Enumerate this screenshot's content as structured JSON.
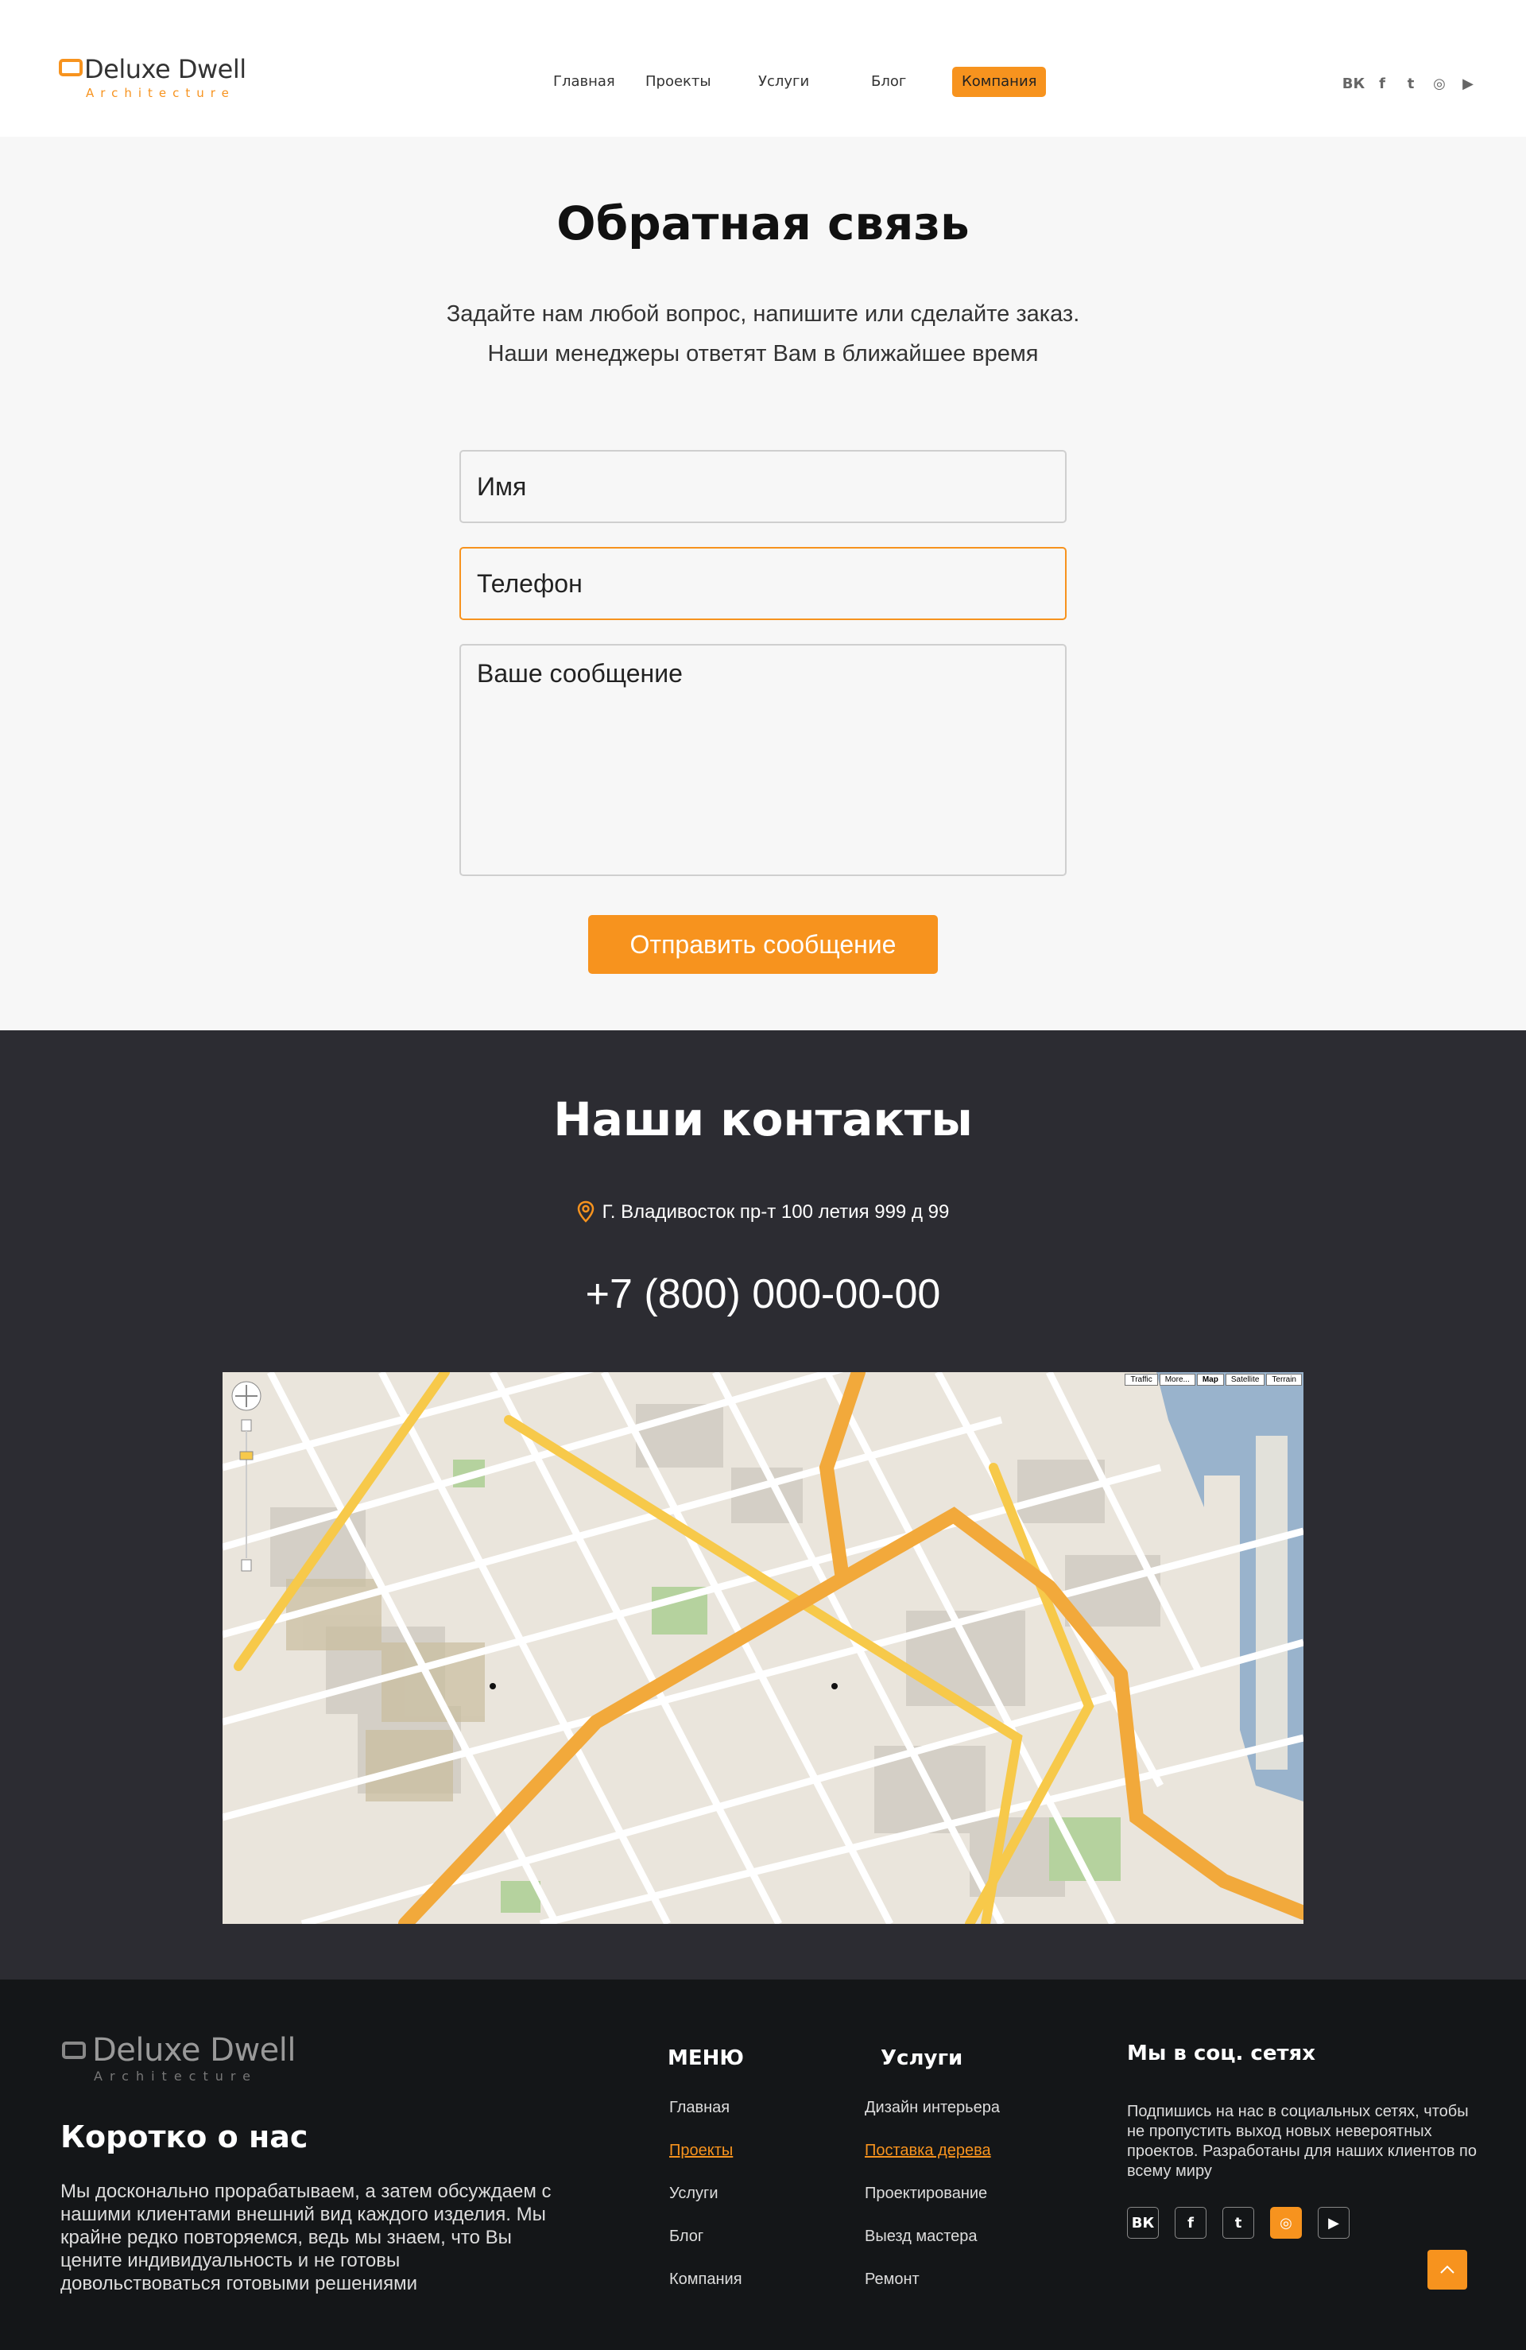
{
  "brand": {
    "name": "Deluxe Dwell",
    "tagline": "Architecture"
  },
  "nav": {
    "items": [
      {
        "label": "Главная"
      },
      {
        "label": "Проекты"
      },
      {
        "label": "Услуги"
      },
      {
        "label": "Блог"
      },
      {
        "label": "Компания"
      }
    ],
    "active_label": "Компания"
  },
  "social_icons": [
    "vk-icon",
    "facebook-icon",
    "twitter-icon",
    "instagram-icon",
    "youtube-icon"
  ],
  "social_glyphs": [
    "ВК",
    "f",
    "t",
    "◎",
    "▶"
  ],
  "feedback": {
    "title": "Обратная связь",
    "subtitle_line1": "Задайте нам любой вопрос, напишите или сделайте заказ.",
    "subtitle_line2": "Наши менеджеры ответят Вам в ближайшее время",
    "name_placeholder": "Имя",
    "phone_placeholder": "Телефон",
    "message_placeholder": "Ваше сообщение",
    "submit_label": "Отправить сообщение"
  },
  "contacts": {
    "title": "Наши контакты",
    "address": "Г. Владивосток пр-т 100 летия 999 д 99",
    "phone": "+7 (800) 000-00-00",
    "map_types": [
      "Traffic",
      "More...",
      "Map",
      "Satellite",
      "Terrain"
    ],
    "map_selected": "Map"
  },
  "footer": {
    "about_title": "Коротко о нас",
    "about_text": "Мы досконально прорабатываем, а затем обсуждаем с нашими клиентами внешний вид каждого изделия. Мы крайне редко повторяемся, ведь мы знаем, что Вы цените индивидуальность и не готовы довольствоваться готовыми решениями",
    "menu_title": "МЕНЮ",
    "menu_items": [
      "Главная",
      "Проекты",
      "Услуги",
      "Блог",
      "Компания"
    ],
    "menu_highlight": "Проекты",
    "services_title": "Услуги",
    "services_items": [
      "Дизайн интерьера",
      "Поставка дерева",
      "Проектирование",
      "Выезд мастера",
      "Ремонт"
    ],
    "services_highlight": "Поставка дерева",
    "social_title": "Мы в соц. сетях",
    "social_text": "Подпишись на нас в социальных сетях, чтобы не пропустить  выход новых невероятных проектов. Разработаны для наших клиентов по всему миру",
    "social_active": "instagram-icon"
  },
  "colors": {
    "accent": "#f7931e",
    "dark": "#2c2c32",
    "footer": "#141618",
    "light_bg": "#f7f7f7"
  }
}
